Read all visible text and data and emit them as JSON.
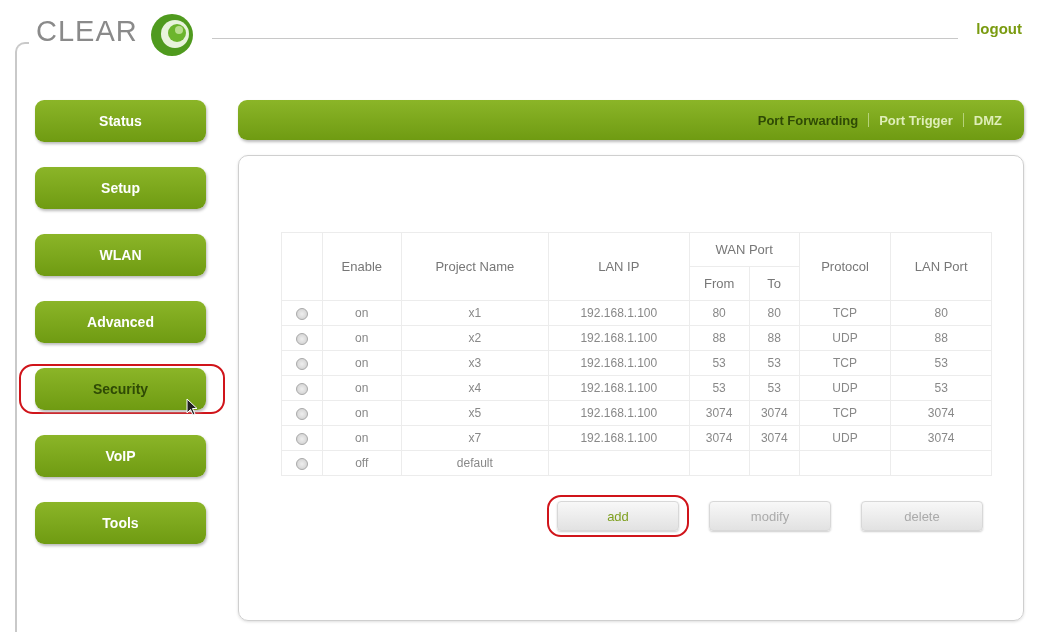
{
  "header": {
    "logo_text": "CLEAR",
    "logout": "logout"
  },
  "sidebar": {
    "items": [
      {
        "label": "Status",
        "selected": false,
        "highlighted": false
      },
      {
        "label": "Setup",
        "selected": false,
        "highlighted": false
      },
      {
        "label": "WLAN",
        "selected": false,
        "highlighted": false
      },
      {
        "label": "Advanced",
        "selected": false,
        "highlighted": false
      },
      {
        "label": "Security",
        "selected": true,
        "highlighted": true
      },
      {
        "label": "VoIP",
        "selected": false,
        "highlighted": false
      },
      {
        "label": "Tools",
        "selected": false,
        "highlighted": false
      }
    ]
  },
  "tabs": [
    {
      "label": "Port Forwarding",
      "selected": true
    },
    {
      "label": "Port Trigger",
      "selected": false
    },
    {
      "label": "DMZ",
      "selected": false
    }
  ],
  "table": {
    "columns": {
      "enable": "Enable",
      "project_name": "Project Name",
      "lan_ip": "LAN IP",
      "wan_port": "WAN Port",
      "from": "From",
      "to": "To",
      "protocol": "Protocol",
      "lan_port": "LAN Port"
    },
    "rows": [
      {
        "selected": false,
        "enable": "on",
        "project_name": "x1",
        "lan_ip": "192.168.1.100",
        "from": "80",
        "to": "80",
        "protocol": "TCP",
        "lan_port": "80"
      },
      {
        "selected": false,
        "enable": "on",
        "project_name": "x2",
        "lan_ip": "192.168.1.100",
        "from": "88",
        "to": "88",
        "protocol": "UDP",
        "lan_port": "88"
      },
      {
        "selected": false,
        "enable": "on",
        "project_name": "x3",
        "lan_ip": "192.168.1.100",
        "from": "53",
        "to": "53",
        "protocol": "TCP",
        "lan_port": "53"
      },
      {
        "selected": false,
        "enable": "on",
        "project_name": "x4",
        "lan_ip": "192.168.1.100",
        "from": "53",
        "to": "53",
        "protocol": "UDP",
        "lan_port": "53"
      },
      {
        "selected": false,
        "enable": "on",
        "project_name": "x5",
        "lan_ip": "192.168.1.100",
        "from": "3074",
        "to": "3074",
        "protocol": "TCP",
        "lan_port": "3074"
      },
      {
        "selected": false,
        "enable": "on",
        "project_name": "x7",
        "lan_ip": "192.168.1.100",
        "from": "3074",
        "to": "3074",
        "protocol": "UDP",
        "lan_port": "3074"
      },
      {
        "selected": false,
        "enable": "off",
        "project_name": "default"
      }
    ]
  },
  "buttons": [
    {
      "label": "add",
      "disabled": false,
      "highlighted": true
    },
    {
      "label": "modify",
      "disabled": true,
      "highlighted": false
    },
    {
      "label": "delete",
      "disabled": true,
      "highlighted": false
    }
  ]
}
